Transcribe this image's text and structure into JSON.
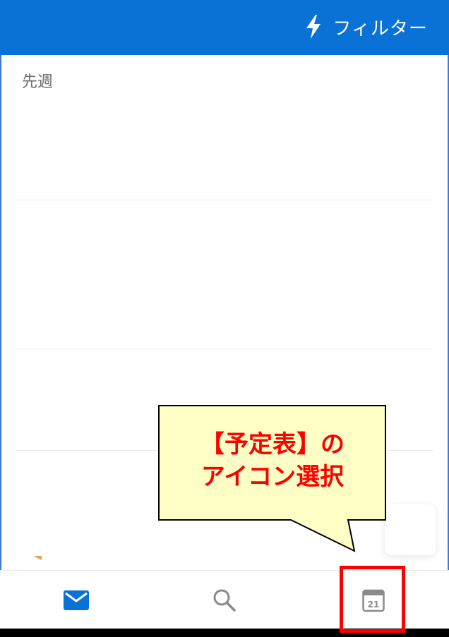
{
  "header": {
    "filter_label": "フィルター",
    "filter_icon": "lightning-bolt-icon",
    "background_color": "#0a72d6"
  },
  "main": {
    "section_label": "先週"
  },
  "tabbar": {
    "items": [
      {
        "icon": "mail-icon",
        "active": true,
        "color": "#0a72d6"
      },
      {
        "icon": "search-icon",
        "active": false,
        "color": "#8a8a8a"
      },
      {
        "icon": "calendar-icon",
        "active": false,
        "color": "#8a8a8a",
        "badge_text": "21"
      }
    ]
  },
  "annotation": {
    "callout_line1": "【予定表】の",
    "callout_line2": "アイコン選択",
    "callout_text_color": "#ff0000",
    "callout_fill_color": "#ffffc6",
    "highlight_color": "#ff0000"
  }
}
